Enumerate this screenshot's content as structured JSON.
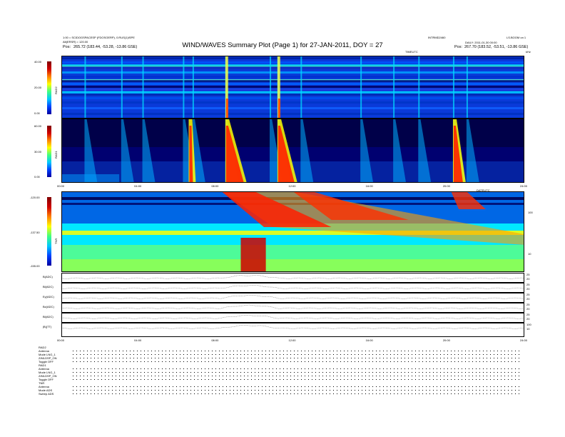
{
  "header": {
    "title": "WIND/WAVES Summary Plot (Page 1) for 27-JAN-2011, DOY = 27",
    "left_line1": "1:00 = SCIDOGSPACESP (FDOSOERP), 0.RUS(1)ISPE",
    "left_line2": "Alt(ERSR) = 120.00",
    "left_pos_label": "Pos:",
    "left_pos": "265.72 (183.44, -53.28, -13.86 GSE)",
    "center_right": "INTRMD2460",
    "daily": "DAILY: 2011-01-30 00:00",
    "right_corner": "LS.BOOM on 1",
    "right_pos_label": "Pos:",
    "right_pos": "267.70 (183.52, -53.51, -13.86 GSE)",
    "unit_top": "kHz",
    "time_label_top": "TIMEUTC",
    "time_label_mid": "DATEUTC"
  },
  "panels": {
    "rad2": {
      "name": "RAD2",
      "ticks": [
        "40.00",
        "20.00",
        "0.00"
      ]
    },
    "rad1": {
      "name": "RAD1",
      "ticks": [
        "60.00",
        "30.00",
        "0.00"
      ]
    },
    "tnr": {
      "name": "TNR",
      "ticks": [
        "-120.00",
        "-137.50",
        "-155.00"
      ],
      "right_ticks": [
        "100",
        "10"
      ]
    }
  },
  "time_axis": {
    "ticks": [
      "00:00",
      "04:00",
      "08:00",
      "12:00",
      "16:00",
      "20:00",
      "24:00"
    ]
  },
  "mag_panels": [
    {
      "label": "B(ADC)",
      "right": [
        "25",
        "20"
      ]
    },
    {
      "label": "Bl(ADC)",
      "right": [
        "25",
        "20"
      ]
    },
    {
      "label": "Ey(ADC)",
      "right": [
        "25",
        "20"
      ]
    },
    {
      "label": "Bz(ADC)",
      "right": [
        "25",
        "20"
      ]
    },
    {
      "label": "Bl(ADC)",
      "right": [
        "25",
        "20"
      ]
    },
    {
      "label": "|B|(TT)",
      "right": [
        "100",
        "10"
      ]
    }
  ],
  "footer_labels": [
    {
      "name": "RAD2",
      "rows": [
        "Antenna",
        "Mode  LNG_1",
        "Z/MLDSP_ON",
        "Toggle  OFF"
      ]
    },
    {
      "name": "RAD1",
      "rows": [
        "Antenna",
        "Mode  LNG_1",
        "Z/MLDSP_ON",
        "Toggle  OFF"
      ]
    },
    {
      "name": "TNR",
      "rows": [
        "Antenna",
        "Mode  ADS",
        "Sweep  ADS"
      ]
    }
  ],
  "chart_data": {
    "type": "heatmap",
    "title": "WIND/WAVES Summary Plot (Page 1) for 27-JAN-2011, DOY = 27",
    "x": [
      "00:00",
      "04:00",
      "08:00",
      "12:00",
      "16:00",
      "20:00",
      "24:00"
    ],
    "xlim": [
      0,
      24
    ],
    "series": [
      {
        "name": "RAD2",
        "ylim": [
          0,
          40
        ]
      },
      {
        "name": "RAD1",
        "ylim": [
          0,
          60
        ]
      },
      {
        "name": "TNR",
        "ylim": [
          -155,
          -120
        ]
      }
    ],
    "bursts_hours": [
      1.2,
      3.1,
      4.2,
      6.3,
      6.8,
      8.5,
      10.8,
      11.2,
      12.4,
      15.5,
      17.2,
      18.5,
      20.3,
      21.0
    ],
    "colors": {
      "low": "#0000a0",
      "mid": "#00ffc0",
      "high": "#ff0000"
    }
  }
}
